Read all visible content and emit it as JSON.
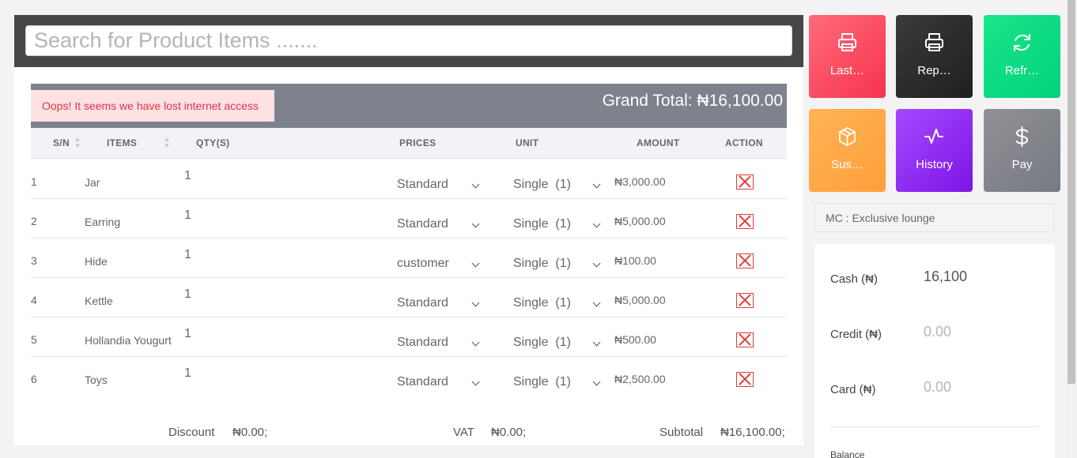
{
  "search": {
    "placeholder": "Search for Product Items ......."
  },
  "alert": {
    "text": "Oops! It seems we have lost internet access"
  },
  "grand_total": {
    "text": "Grand Total: ₦16,100.00"
  },
  "table": {
    "headers": {
      "sn": "S/N",
      "items": "ITEMS",
      "qty": "QTY(S)",
      "prices": "PRICES",
      "unit": "UNIT",
      "amount": "AMOUNT",
      "action": "ACTION"
    },
    "rows": [
      {
        "sn": "1",
        "item": "Jar",
        "qty": "1",
        "price": "Standard",
        "unit": "Single  (1)",
        "amount": "₦3,000.00"
      },
      {
        "sn": "2",
        "item": "Earring",
        "qty": "1",
        "price": "Standard",
        "unit": "Single  (1)",
        "amount": "₦5,000.00"
      },
      {
        "sn": "3",
        "item": "Hide",
        "qty": "1",
        "price": "customer",
        "unit": "Single  (1)",
        "amount": "₦100.00"
      },
      {
        "sn": "4",
        "item": "Kettle",
        "qty": "1",
        "price": "Standard",
        "unit": "Single  (1)",
        "amount": "₦5,000.00"
      },
      {
        "sn": "5",
        "item": "Hollandia Yougurt",
        "qty": "1",
        "price": "Standard",
        "unit": "Single  (1)",
        "amount": "₦500.00"
      },
      {
        "sn": "6",
        "item": "Toys",
        "qty": "1",
        "price": "Standard",
        "unit": "Single  (1)",
        "amount": "₦2,500.00"
      }
    ]
  },
  "footer": {
    "discount_label": "Discount",
    "discount_value": "₦0.00;",
    "vat_label": "VAT",
    "vat_value": "₦0.00;",
    "subtotal_label": "Subtotal",
    "subtotal_value": "₦16,100.00;"
  },
  "actions": {
    "last": {
      "label": "Last…",
      "icon": "printer-icon"
    },
    "report": {
      "label": "Rep…",
      "icon": "printer-icon"
    },
    "refresh": {
      "label": "Refr…",
      "icon": "refresh-icon"
    },
    "suspend": {
      "label": "Sus…",
      "icon": "box-icon"
    },
    "history": {
      "label": "History",
      "icon": "activity-icon"
    },
    "pay": {
      "label": "Pay",
      "icon": "dollar-icon"
    }
  },
  "customer": {
    "text": "MC : Exclusive lounge"
  },
  "payment": {
    "cash_label": "Cash (₦)",
    "cash_value": "16,100",
    "credit_label": "Credit (₦)",
    "credit_placeholder": "0.00",
    "card_label": "Card (₦)",
    "card_placeholder": "0.00",
    "balance_label": "Balance"
  },
  "colors": {
    "last": "#f7334e",
    "report": "#2a2a2a",
    "refresh": "#03d27a",
    "suspend": "#ff9f3b",
    "history": "#7b15e6",
    "pay": "#7f8288",
    "total_bar": "#7e828c",
    "alert_text": "#dc3545"
  }
}
